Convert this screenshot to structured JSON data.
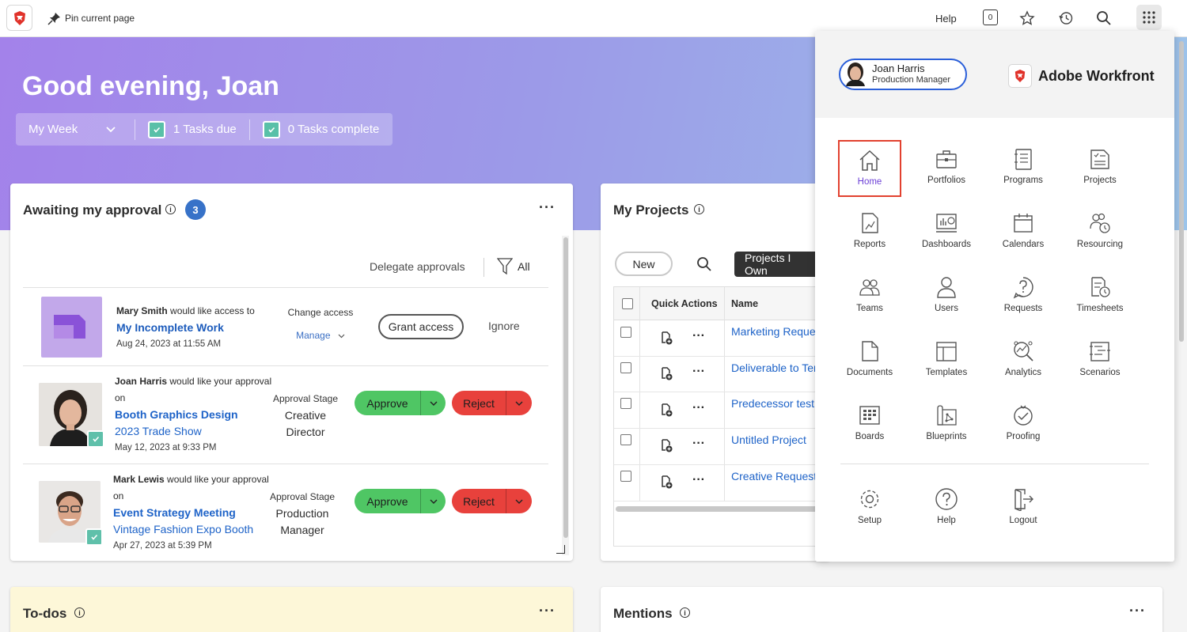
{
  "topbar": {
    "pin_label": "Pin current page",
    "help_label": "Help",
    "notification_count": "0"
  },
  "hero": {
    "greeting": "Good evening, Joan",
    "week_label": "My Week",
    "tasks_due": "1 Tasks due",
    "tasks_complete": "0 Tasks complete"
  },
  "approvals": {
    "title": "Awaiting my approval",
    "count": "3",
    "delegate_label": "Delegate approvals",
    "filter_label": "All",
    "items": [
      {
        "requester": "Mary Smith",
        "action": "would like access to",
        "object": "My Incomplete Work",
        "date": "Aug 24, 2023 at 11:55 AM",
        "stage_label": "Change access",
        "stage_value": "Manage",
        "primary": "Grant access",
        "secondary": "Ignore"
      },
      {
        "requester": "Joan Harris",
        "action": "would like your approval",
        "on": "on",
        "object": "Booth Graphics Design",
        "project": "2023 Trade Show",
        "date": "May 12, 2023 at 9:33 PM",
        "stage_label": "Approval Stage",
        "stage_line1": "Creative",
        "stage_line2": "Director",
        "approve": "Approve",
        "reject": "Reject"
      },
      {
        "requester": "Mark Lewis",
        "action": "would like your approval",
        "on": "on",
        "object": "Event Strategy Meeting",
        "project": "Vintage Fashion Expo Booth",
        "date": "Apr 27, 2023 at 5:39 PM",
        "stage_label": "Approval Stage",
        "stage_line1": "Production",
        "stage_line2": "Manager",
        "approve": "Approve",
        "reject": "Reject"
      }
    ]
  },
  "projects": {
    "title": "My Projects",
    "new_label": "New",
    "filter_label": "Projects I Own",
    "columns": [
      "Quick Actions",
      "Name"
    ],
    "rows": [
      "Marketing Request",
      "Deliverable to Tem",
      "Predecessor test pr",
      "Untitled Project",
      "Creative Requests"
    ]
  },
  "todos": {
    "title": "To-dos"
  },
  "mentions": {
    "title": "Mentions"
  },
  "panel": {
    "user_name": "Joan Harris",
    "user_role": "Production Manager",
    "brand": "Adobe Workfront",
    "apps": [
      {
        "label": "Home",
        "icon": "home-icon"
      },
      {
        "label": "Portfolios",
        "icon": "briefcase-icon"
      },
      {
        "label": "Programs",
        "icon": "program-icon"
      },
      {
        "label": "Projects",
        "icon": "project-icon"
      },
      {
        "label": "Reports",
        "icon": "report-icon"
      },
      {
        "label": "Dashboards",
        "icon": "dashboard-icon"
      },
      {
        "label": "Calendars",
        "icon": "calendar-icon"
      },
      {
        "label": "Resourcing",
        "icon": "resourcing-icon"
      },
      {
        "label": "Teams",
        "icon": "teams-icon"
      },
      {
        "label": "Users",
        "icon": "user-icon"
      },
      {
        "label": "Requests",
        "icon": "request-icon"
      },
      {
        "label": "Timesheets",
        "icon": "timesheet-icon"
      },
      {
        "label": "Documents",
        "icon": "document-icon"
      },
      {
        "label": "Templates",
        "icon": "template-icon"
      },
      {
        "label": "Analytics",
        "icon": "analytics-icon"
      },
      {
        "label": "Scenarios",
        "icon": "scenario-icon"
      },
      {
        "label": "Boards",
        "icon": "board-icon"
      },
      {
        "label": "Blueprints",
        "icon": "blueprint-icon"
      },
      {
        "label": "Proofing",
        "icon": "proofing-icon"
      }
    ],
    "footer_apps": [
      {
        "label": "Setup",
        "icon": "gear-icon"
      },
      {
        "label": "Help",
        "icon": "help-icon"
      },
      {
        "label": "Logout",
        "icon": "logout-icon"
      }
    ]
  },
  "colors": {
    "accent": "#1e63c8",
    "approve": "#4fc664",
    "reject": "#e8413c",
    "active_outline": "#e2412f",
    "badge": "#3772c8"
  }
}
